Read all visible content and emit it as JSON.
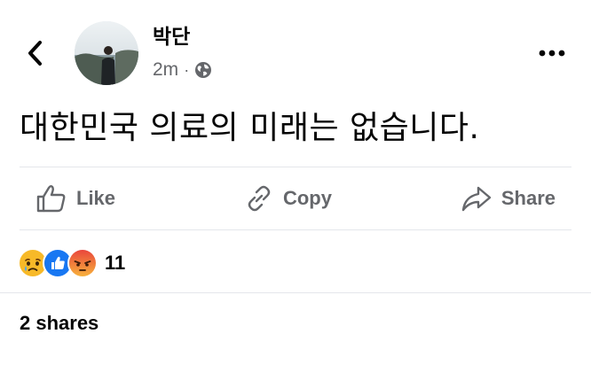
{
  "post": {
    "author_name": "박단",
    "time_ago": "2m",
    "separator": "·",
    "audience_icon": "globe-icon",
    "text": "대한민국 의료의 미래는 없습니다."
  },
  "header": {
    "back_icon": "chevron-left-icon",
    "more_icon": "more-dots-icon"
  },
  "actions": {
    "like_label": "Like",
    "copy_label": "Copy",
    "share_label": "Share"
  },
  "reactions": {
    "icons": [
      "sad-reaction-icon",
      "like-reaction-icon",
      "angry-reaction-icon"
    ],
    "count": "11"
  },
  "shares": {
    "label": "2 shares"
  },
  "colors": {
    "text_primary": "#050505",
    "text_secondary": "#65676b",
    "divider": "#e4e6eb",
    "like_blue": "#1877f2",
    "sad_yellow": "#f7b928",
    "angry_red": "#e9710f"
  }
}
